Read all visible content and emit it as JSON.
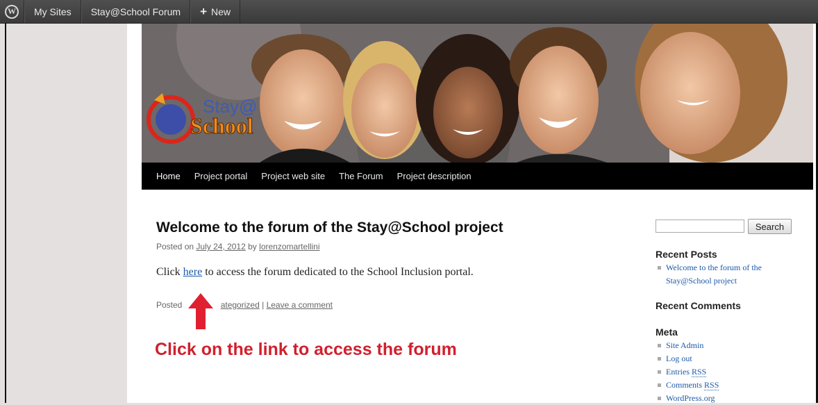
{
  "adminbar": {
    "logo_icon": "wordpress-logo-icon",
    "logo_glyph": "W",
    "my_sites": "My Sites",
    "site_name": "Stay@School Forum",
    "new_label": "New",
    "plus_glyph": "+"
  },
  "header": {
    "logo_text_top": "Stay@",
    "logo_text_bottom": "School"
  },
  "nav": {
    "items": [
      {
        "label": "Home"
      },
      {
        "label": "Project portal"
      },
      {
        "label": "Project web site"
      },
      {
        "label": "The Forum"
      },
      {
        "label": "Project description"
      }
    ]
  },
  "post": {
    "title": "Welcome to the forum of the Stay@School project",
    "posted_on": "Posted on",
    "date": "July 24, 2012",
    "by": "by",
    "author": "lorenzomartellini",
    "body_prefix": "Click",
    "body_link": "here",
    "body_suffix": "to access the forum dedicated to the School Inclusion portal.",
    "footer_prefix": "Posted",
    "footer_category": "ategorized",
    "footer_sep": "|",
    "footer_comment": "Leave a comment"
  },
  "annotation": {
    "text": "Click on the link to access the forum",
    "color": "#d1202e"
  },
  "sidebar": {
    "search_button": "Search",
    "search_value": "",
    "recent_posts_title": "Recent Posts",
    "recent_posts": [
      {
        "line1": "Welcome to the forum of the",
        "line2": "Stay@School project"
      }
    ],
    "recent_comments_title": "Recent Comments",
    "meta_title": "Meta",
    "meta_items": {
      "site_admin": "Site Admin",
      "log_out": "Log out",
      "entries_prefix": "Entries",
      "entries_rss": "RSS",
      "comments_prefix": "Comments",
      "comments_rss": "RSS",
      "wordpress": "WordPress.org"
    }
  }
}
